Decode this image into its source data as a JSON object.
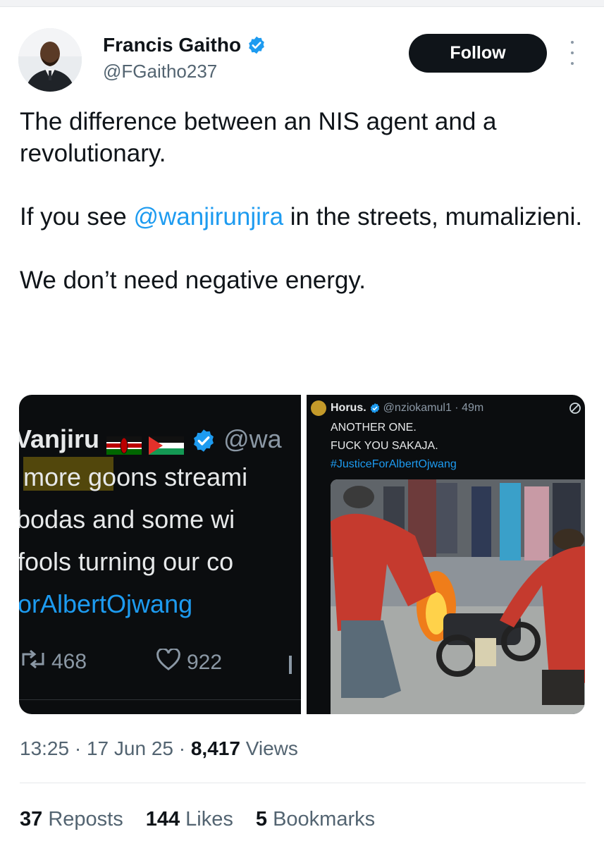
{
  "author": {
    "name": "Francis Gaitho",
    "handle": "@FGaitho237"
  },
  "follow_button": {
    "label": "Follow"
  },
  "tweet": {
    "line1": "The difference between an NIS agent and a revolutionary.",
    "line2_before": "If you see ",
    "line2_mention": "@wanjirunjira",
    "line2_after": " in the streets, mumalizieni.",
    "line3": "We don’t need negative energy."
  },
  "media_left": {
    "name": "Vanjiru",
    "handle_fragment": "@wa",
    "text_lines": [
      "more goons streami",
      "bodas and some wi",
      "fools turning our co",
      "orAlbertOjwang"
    ],
    "retweet_count": "468",
    "like_count": "922"
  },
  "media_right": {
    "name": "Horus.",
    "handle_time": "@nziokamul1 · 49m",
    "lines": [
      "ANOTHER ONE.",
      "FUCK YOU SAKAJA.",
      "#JusticeForAlbertOjwang"
    ]
  },
  "meta": {
    "time": "13:25",
    "date": "17 Jun 25",
    "views_count": "8,417",
    "views_label": "Views"
  },
  "stats": {
    "reposts_count": "37",
    "reposts_label": "Reposts",
    "likes_count": "144",
    "likes_label": "Likes",
    "bookmarks_count": "5",
    "bookmarks_label": "Bookmarks"
  },
  "colors": {
    "link": "#1d9bf0",
    "verified": "#1d9bf0",
    "follow_bg": "#0f1419",
    "secondary_text": "#536471"
  }
}
